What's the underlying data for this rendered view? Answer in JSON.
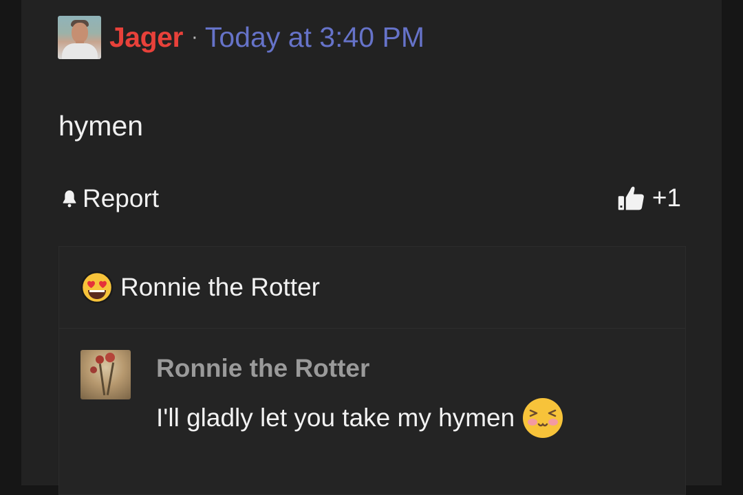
{
  "post": {
    "author": "Jager",
    "separator": "·",
    "timestamp": "Today at 3:40 PM",
    "body": "hymen"
  },
  "actions": {
    "report_label": "Report",
    "like_count": "+1"
  },
  "quote": {
    "reaction_user": "Ronnie the Rotter",
    "reaction_emoji": "heart-eyes-emoji",
    "quoted_author": "Ronnie the Rotter",
    "quoted_text": "I'll gladly let you take my hymen",
    "quoted_emoji": "blush-emoji"
  },
  "colors": {
    "author": "#e8413a",
    "timestamp": "#6673c9",
    "background": "#222222"
  }
}
